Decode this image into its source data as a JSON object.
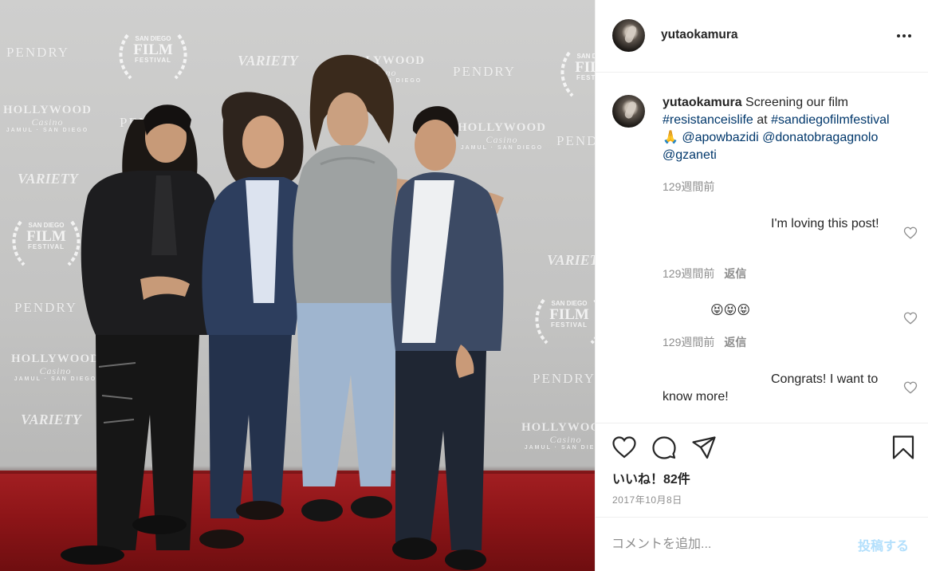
{
  "post": {
    "username": "yutaokamura",
    "more_label": "•••"
  },
  "photo": {
    "logos": {
      "pendry": "PENDRY",
      "variety": "VARIETY",
      "hollywood": "HOLLYWOOD",
      "casino": "Casino",
      "jamul": "JAMUL · SAN DIEGO",
      "festival_top": "SAN DIEGO",
      "festival_film": "FILM",
      "festival_bottom": "FESTIVAL"
    }
  },
  "caption": {
    "username": "yutaokamura",
    "text_1": " Screening our film ",
    "hashtag_1": "#resistanceislife",
    "text_2": " at ",
    "hashtag_2": "#sandiegofilmfestival",
    "emoji": "🙏",
    "mention_1": "@apowbazidi",
    "mention_2": "@donatobragagnolo",
    "mention_3": "@gzaneti",
    "time": "129週間前"
  },
  "comments": [
    {
      "text": "I'm loving this post!",
      "time": "129週間前",
      "reply": "返信"
    },
    {
      "text": "😝😝😝",
      "time": "129週間前",
      "reply": "返信"
    },
    {
      "text": "Congrats! I want to know more!"
    }
  ],
  "actions": {
    "likes": "いいね！82件",
    "date": "2017年10月8日"
  },
  "add_comment": {
    "placeholder": "コメントを追加...",
    "post_label": "投稿する"
  },
  "colors": {
    "link": "#00376b",
    "muted": "#8e8e8e",
    "post_button_disabled": "#b2dffc"
  }
}
